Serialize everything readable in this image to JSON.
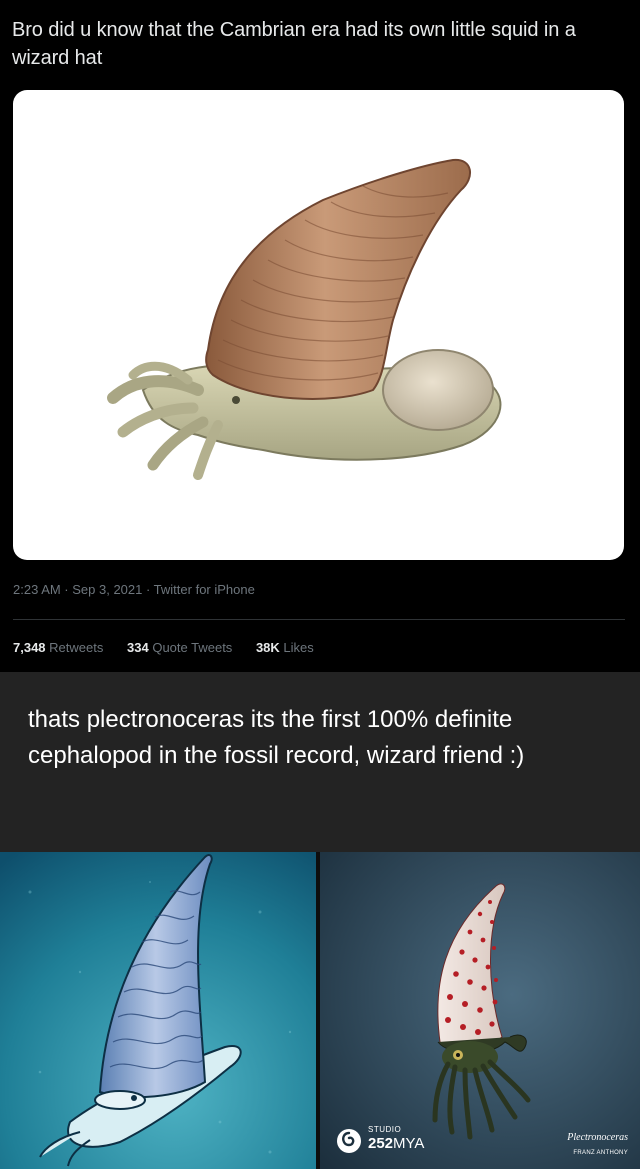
{
  "tweet": {
    "text": "Bro did u know that the Cambrian era had its own little squid in a wizard hat",
    "meta": "2:23 AM · Sep 3, 2021 · Twitter for iPhone",
    "stats": [
      {
        "value": "7,348",
        "label": "Retweets"
      },
      {
        "value": "334",
        "label": "Quote Tweets"
      },
      {
        "value": "38K",
        "label": "Likes"
      }
    ]
  },
  "reply": {
    "text": "thats plectronoceras its the first 100% definite cephalopod in the fossil record, wizard friend :)"
  },
  "right_image": {
    "studio_small": "STUDIO",
    "studio_number": "252",
    "studio_suffix": "MYA",
    "credit_title": "Plectronoceras",
    "credit_author": "FRANZ ANTHONY"
  },
  "colors": {
    "tweet_bg": "#000000",
    "tweet_text": "#e7e9ea",
    "tweet_muted": "#6e767d",
    "tumblr_bg": "#232323",
    "left_panel_bg": "#1a6f86",
    "right_panel_bg": "#2f4a5d"
  }
}
